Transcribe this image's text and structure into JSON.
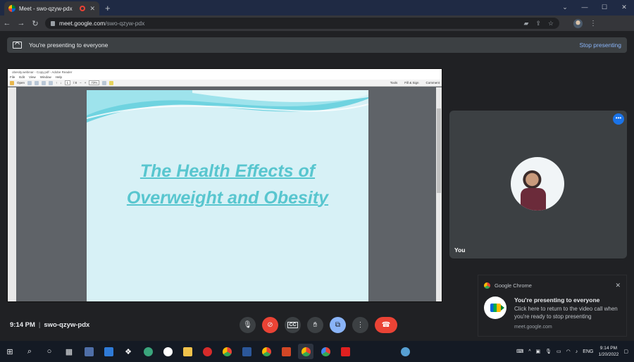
{
  "browser": {
    "tab_title": "Meet - swo-qzyw-pdx",
    "url_host": "meet.google.com",
    "url_path": "/swo-qzyw-pdx"
  },
  "banner": {
    "text": "You're presenting to everyone",
    "stop_label": "Stop presenting"
  },
  "shared_screen": {
    "window_title": "obesity.webinar - Copy.pdf - Adobe Reader",
    "menu": [
      "File",
      "Edit",
      "View",
      "Window",
      "Help"
    ],
    "open_label": "Open",
    "page_number": "1",
    "page_total": "/ 8",
    "zoom": "73%",
    "tools_labels": [
      "Tools",
      "Fill & Sign",
      "Comment"
    ],
    "slide_title_line1": "The Health Effects of",
    "slide_title_line2": "Overweight and Obesity"
  },
  "self_tile": {
    "name": "You"
  },
  "notification": {
    "app": "Google Chrome",
    "title": "You're presenting to everyone",
    "message": "Click here to return to the video call when you're ready to stop presenting",
    "source": "meet.google.com"
  },
  "meeting": {
    "time": "9:14 PM",
    "code": "swo-qzyw-pdx"
  },
  "taskbar": {
    "lang": "ENG",
    "clock_time": "9:14 PM",
    "clock_date": "1/20/2022"
  }
}
